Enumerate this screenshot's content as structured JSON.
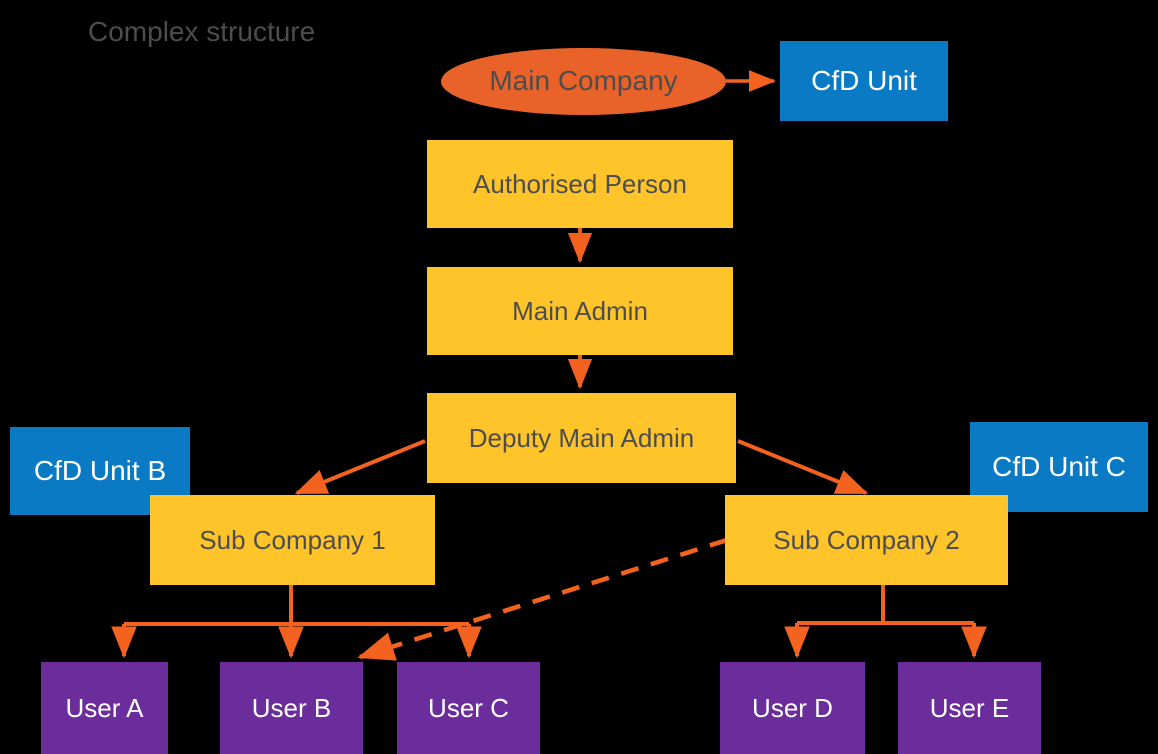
{
  "diagram": {
    "title": "Complex structure",
    "title_color": "#4D4D4D",
    "background_color": "#000000",
    "palette": {
      "yellow": "#FFC429",
      "blue": "#0B7AC4",
      "purple": "#6B2D9B",
      "orange": "#E8622A",
      "arrow": "#F4621F",
      "dark_text": "#4D4D4D",
      "light_text": "#FFFFFF"
    },
    "nodes": {
      "main_company": "Main Company",
      "cfd_unit": "CfD Unit",
      "authorised_person": "Authorised Person",
      "main_admin": "Main Admin",
      "deputy_main_admin": "Deputy Main Admin",
      "cfd_unit_b": "CfD Unit B",
      "cfd_unit_c": "CfD Unit C",
      "sub_company_1": "Sub Company 1",
      "sub_company_2": "Sub Company 2",
      "user_a": "User A",
      "user_b": "User B",
      "user_c": "User C",
      "user_d": "User D",
      "user_e": "User E"
    },
    "edges": [
      {
        "from": "Main Company",
        "to": "CfD Unit",
        "style": "solid"
      },
      {
        "from": "Authorised Person",
        "to": "Main Admin",
        "style": "solid"
      },
      {
        "from": "Main Admin",
        "to": "Deputy Main Admin",
        "style": "solid"
      },
      {
        "from": "Deputy Main Admin",
        "to": "Sub Company 1",
        "style": "solid"
      },
      {
        "from": "Deputy Main Admin",
        "to": "Sub Company 2",
        "style": "solid"
      },
      {
        "from": "Sub Company 1",
        "to": "User A",
        "style": "solid"
      },
      {
        "from": "Sub Company 1",
        "to": "User B",
        "style": "solid"
      },
      {
        "from": "Sub Company 1",
        "to": "User C",
        "style": "solid"
      },
      {
        "from": "Sub Company 2",
        "to": "User D",
        "style": "solid"
      },
      {
        "from": "Sub Company 2",
        "to": "User E",
        "style": "solid"
      },
      {
        "from": "Sub Company 2",
        "to": "User B",
        "style": "dashed"
      }
    ]
  }
}
